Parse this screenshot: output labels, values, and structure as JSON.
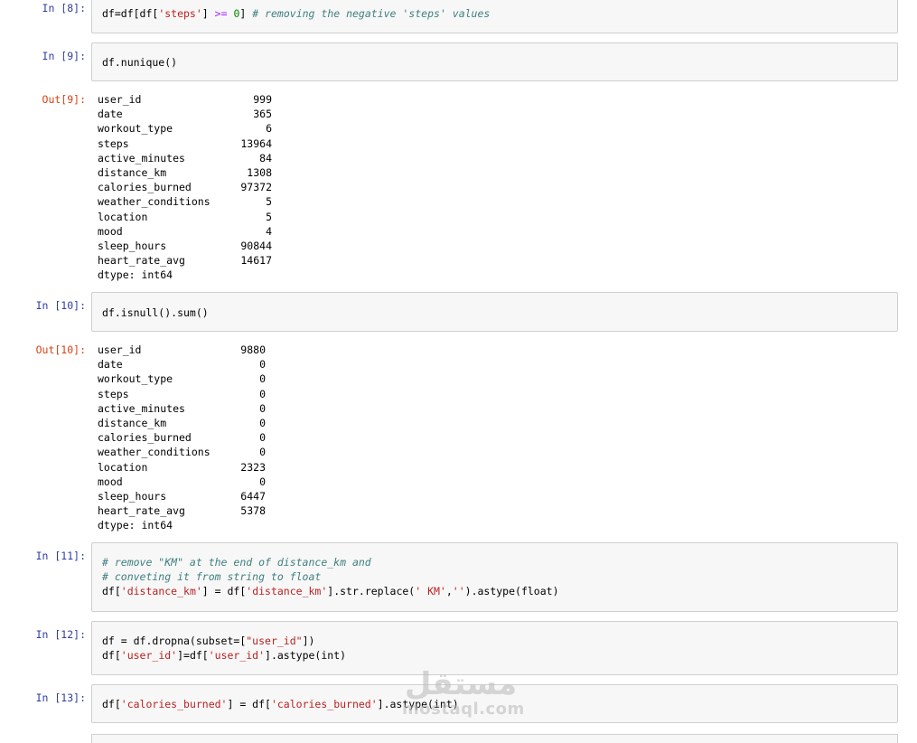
{
  "cells": {
    "c8": {
      "prompt": "In [8]:"
    },
    "c9": {
      "prompt": "In [9]:",
      "out_prompt": "Out[9]:"
    },
    "c10": {
      "prompt": "In [10]:",
      "out_prompt": "Out[10]:"
    },
    "c11": {
      "prompt": "In [11]:"
    },
    "c12": {
      "prompt": "In [12]:"
    },
    "c13": {
      "prompt": "In [13]:"
    }
  },
  "code": {
    "c8_a": "df=df[df[",
    "c8_b": "'steps'",
    "c8_c": "] ",
    "c8_d": ">=",
    "c8_e": " ",
    "c8_f": "0",
    "c8_g": "] ",
    "c8_h": "# removing the negative 'steps' values",
    "c9": "df.nunique()",
    "c10": "df.isnull().sum()",
    "c11_l1": "# remove \"KM\" at the end of distance_km and",
    "c11_l2": "# conveting it from string to float",
    "c11_l3_a": "df[",
    "c11_l3_b": "'distance_km'",
    "c11_l3_c": "] = df[",
    "c11_l3_d": "'distance_km'",
    "c11_l3_e": "].str.replace(",
    "c11_l3_f": "' KM'",
    "c11_l3_g": ",",
    "c11_l3_h": "''",
    "c11_l3_i": ").astype(float)",
    "c12_l1_a": "df = df.dropna(subset=[",
    "c12_l1_b": "\"user_id\"",
    "c12_l1_c": "])",
    "c12_l2_a": "df[",
    "c12_l2_b": "'user_id'",
    "c12_l2_c": "]=df[",
    "c12_l2_d": "'user_id'",
    "c12_l2_e": "].astype(int)",
    "c13_a": "df[",
    "c13_b": "'calories_burned'",
    "c13_c": "] = df[",
    "c13_d": "'calories_burned'",
    "c13_e": "].astype(int)"
  },
  "outputs": {
    "nunique": [
      {
        "key": "user_id",
        "val": "999"
      },
      {
        "key": "date",
        "val": "365"
      },
      {
        "key": "workout_type",
        "val": "6"
      },
      {
        "key": "steps",
        "val": "13964"
      },
      {
        "key": "active_minutes",
        "val": "84"
      },
      {
        "key": "distance_km",
        "val": "1308"
      },
      {
        "key": "calories_burned",
        "val": "97372"
      },
      {
        "key": "weather_conditions",
        "val": "5"
      },
      {
        "key": "location",
        "val": "5"
      },
      {
        "key": "mood",
        "val": "4"
      },
      {
        "key": "sleep_hours",
        "val": "90844"
      },
      {
        "key": "heart_rate_avg",
        "val": "14617"
      },
      {
        "key": "dtype: int64",
        "val": ""
      }
    ],
    "isnull": [
      {
        "key": "user_id",
        "val": "9880"
      },
      {
        "key": "date",
        "val": "0"
      },
      {
        "key": "workout_type",
        "val": "0"
      },
      {
        "key": "steps",
        "val": "0"
      },
      {
        "key": "active_minutes",
        "val": "0"
      },
      {
        "key": "distance_km",
        "val": "0"
      },
      {
        "key": "calories_burned",
        "val": "0"
      },
      {
        "key": "weather_conditions",
        "val": "0"
      },
      {
        "key": "location",
        "val": "2323"
      },
      {
        "key": "mood",
        "val": "0"
      },
      {
        "key": "sleep_hours",
        "val": "6447"
      },
      {
        "key": "heart_rate_avg",
        "val": "5378"
      },
      {
        "key": "dtype: int64",
        "val": ""
      }
    ]
  },
  "watermark": {
    "arabic": "مستقل",
    "latin": "mostaql.com"
  },
  "colors": {
    "in_prompt": "#303f9f",
    "out_prompt": "#d84315",
    "string": "#ba2121",
    "comment": "#408080",
    "cell_bg": "#f7f7f7"
  }
}
